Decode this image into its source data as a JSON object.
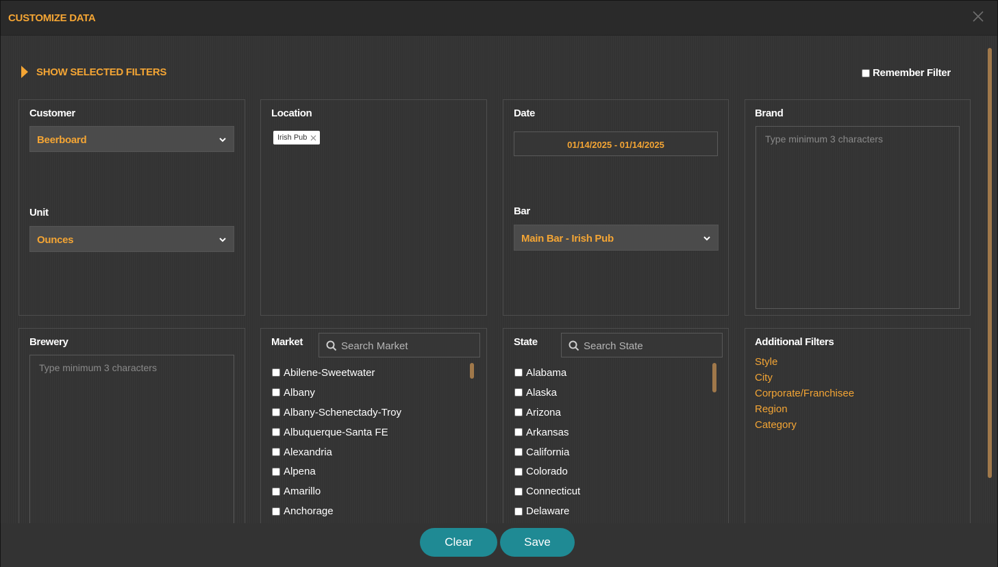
{
  "header": {
    "title": "CUSTOMIZE DATA",
    "close_icon": "close-icon"
  },
  "show_selected_filters": "SHOW SELECTED FILTERS",
  "remember_filter": "Remember Filter",
  "customer": {
    "title": "Customer",
    "value": "Beerboard"
  },
  "unit": {
    "title": "Unit",
    "value": "Ounces"
  },
  "location": {
    "title": "Location",
    "chip": "Irish Pub"
  },
  "date": {
    "title": "Date",
    "value": "01/14/2025 - 01/14/2025"
  },
  "bar": {
    "title": "Bar",
    "value": "Main Bar - Irish Pub"
  },
  "brand": {
    "title": "Brand",
    "placeholder": "Type minimum 3 characters"
  },
  "brewery": {
    "title": "Brewery",
    "placeholder": "Type minimum 3 characters"
  },
  "market": {
    "title": "Market",
    "search_placeholder": "Search Market",
    "items": [
      "Abilene-Sweetwater",
      "Albany",
      "Albany-Schenectady-Troy",
      "Albuquerque-Santa FE",
      "Alexandria",
      "Alpena",
      "Amarillo",
      "Anchorage"
    ]
  },
  "state": {
    "title": "State",
    "search_placeholder": "Search State",
    "items": [
      "Alabama",
      "Alaska",
      "Arizona",
      "Arkansas",
      "California",
      "Colorado",
      "Connecticut",
      "Delaware"
    ]
  },
  "additional_filters": {
    "title": "Additional Filters",
    "items": [
      "Style",
      "City",
      "Corporate/Franchisee",
      "Region",
      "Category"
    ]
  },
  "buttons": {
    "clear": "Clear",
    "save": "Save"
  },
  "colors": {
    "accent": "#f4a534",
    "button": "#1f8a94",
    "scrollbar": "#a0784a"
  }
}
